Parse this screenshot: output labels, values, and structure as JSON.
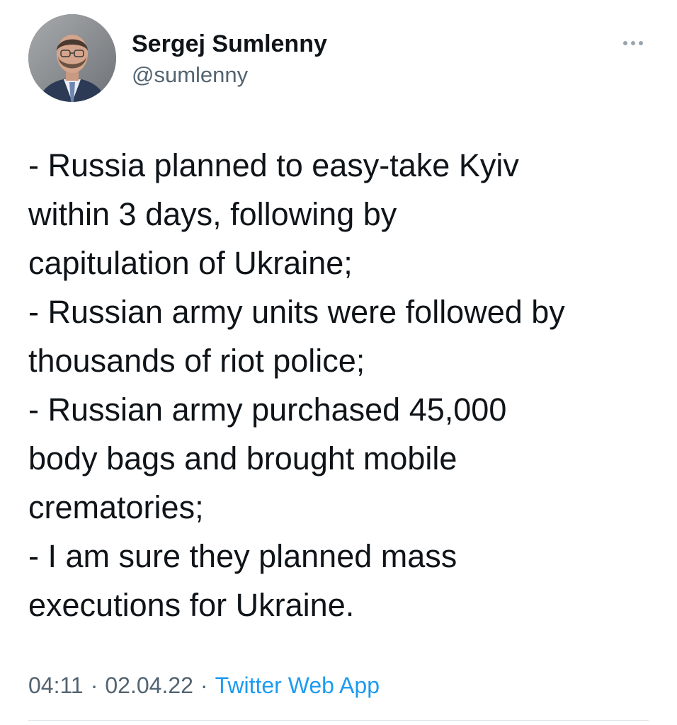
{
  "author": {
    "display_name": "Sergej Sumlenny",
    "handle": "@sumlenny",
    "avatar_icon": "profile-photo"
  },
  "actions": {
    "more_icon": "more-horizontal-icon"
  },
  "tweet": {
    "lines": [
      "- Russia planned to easy-take Kyiv",
      "within 3 days, following by",
      "capitulation of Ukraine;",
      "- Russian army units were followed by",
      "thousands of riot police;",
      "- Russian army purchased 45,000",
      "body bags and brought mobile",
      "crematories;",
      "- I am sure they planned mass",
      "executions for Ukraine."
    ]
  },
  "meta": {
    "time": "04:11",
    "separator": "·",
    "date": "02.04.22",
    "source": "Twitter Web App"
  },
  "colors": {
    "text_primary": "#0f1419",
    "text_secondary": "#536471",
    "link": "#1d9bf0",
    "divider": "#e1e6ea"
  }
}
